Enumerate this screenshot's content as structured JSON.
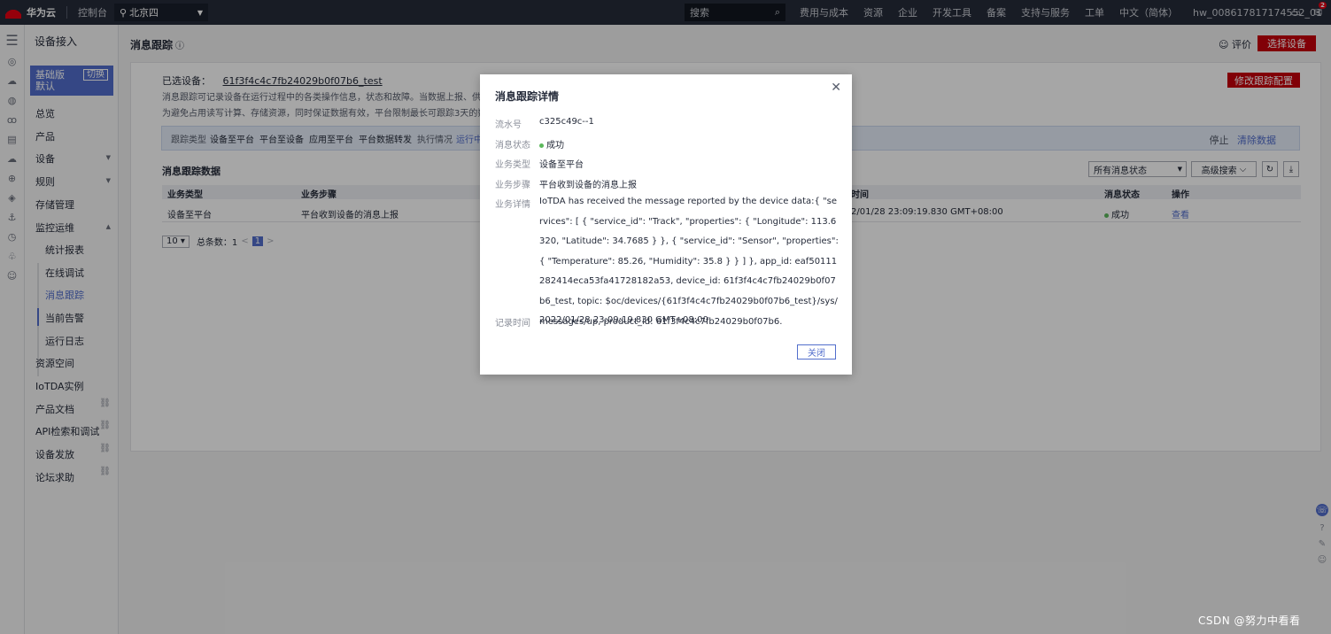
{
  "topbar": {
    "brand": "华为云",
    "console": "控制台",
    "region": "北京四",
    "search_placeholder": "搜索",
    "nav": [
      "费用与成本",
      "资源",
      "企业",
      "开发工具",
      "备案",
      "支持与服务",
      "工单",
      "中文（简体）",
      "hw_008617817174552_01"
    ],
    "badge_count": "2"
  },
  "sidemenu": {
    "title": "设备接入",
    "instance_label": "基础版",
    "instance_sub": "默认",
    "switch_label": "切换",
    "items": [
      "总览",
      "产品",
      "设备",
      "规则",
      "存储管理",
      "监控运维"
    ],
    "sub_items": [
      "统计报表",
      "在线调试",
      "消息跟踪",
      "当前告警",
      "运行日志"
    ],
    "bottom_items": [
      "资源空间",
      "IoTDA实例",
      "产品文档",
      "API检索和调试",
      "设备发放",
      "论坛求助"
    ]
  },
  "header": {
    "title": "消息跟踪",
    "rate": "评价",
    "select_device": "选择设备"
  },
  "panel": {
    "selected_label": "已选设备：",
    "device_id": "61f3f4c4c7fb24029b0f07b6_test",
    "desc_line1": "消息跟踪可记录设备在运行过程中的各类操作信息，状态和故障。当数据上报、供应商",
    "desc_line2": "为避免占用读写计算、存储资源，同时保证数据有效，平台限制最长可跟踪3天的数据",
    "modify_btn": "修改跟踪配置",
    "trace_type_label": "跟踪类型",
    "trace_types": [
      "设备至平台",
      "平台至设备",
      "应用至平台",
      "平台数据转发"
    ],
    "exec_label": "执行情况",
    "exec_status": "运行中",
    "stop": "停止",
    "clear": "清除数据",
    "data_title": "消息跟踪数据",
    "filter_status": "所有消息状态",
    "advanced_search": "高级搜索",
    "columns": [
      "业务类型",
      "业务步骤",
      "时间",
      "消息状态",
      "操作"
    ],
    "rows": [
      {
        "type": "设备至平台",
        "step": "平台收到设备的消息上报",
        "time": "2/01/28 23:09:19.830 GMT+08:00",
        "status": "成功",
        "action": "查看"
      }
    ],
    "page_size": "10",
    "total_label": "总条数：1",
    "current_page": "1"
  },
  "modal": {
    "title": "消息跟踪详情",
    "fields": [
      {
        "key": "流水号",
        "value": "c325c49c--1"
      },
      {
        "key": "消息状态",
        "value": "成功"
      },
      {
        "key": "业务类型",
        "value": "设备至平台"
      },
      {
        "key": "业务步骤",
        "value": "平台收到设备的消息上报"
      },
      {
        "key": "业务详情",
        "value": "IoTDA has received the message reported by the device data:{ \"services\": [ { \"service_id\": \"Track\", \"properties\": { \"Longitude\": 113.6320, \"Latitude\": 34.7685 } }, { \"service_id\": \"Sensor\", \"properties\": { \"Temperature\": 85.26, \"Humidity\": 35.8 } } ] }, app_id: eaf50111282414eca53fa41728182a53, device_id: 61f3f4c4c7fb24029b0f07b6_test, topic: $oc/devices/{61f3f4c4c7fb24029b0f07b6_test}/sys/messages/up, product_id: 61f3f4c4c7fb24029b0f07b6."
      },
      {
        "key": "记录时间",
        "value": "2022/01/28 23:09:19.830 GMT+08:00"
      }
    ],
    "close_btn": "关闭"
  },
  "watermark": "CSDN @努力中看看",
  "colors": {
    "accent": "#526ecc",
    "brand_red": "#c7000b",
    "success": "#5cb85c"
  }
}
